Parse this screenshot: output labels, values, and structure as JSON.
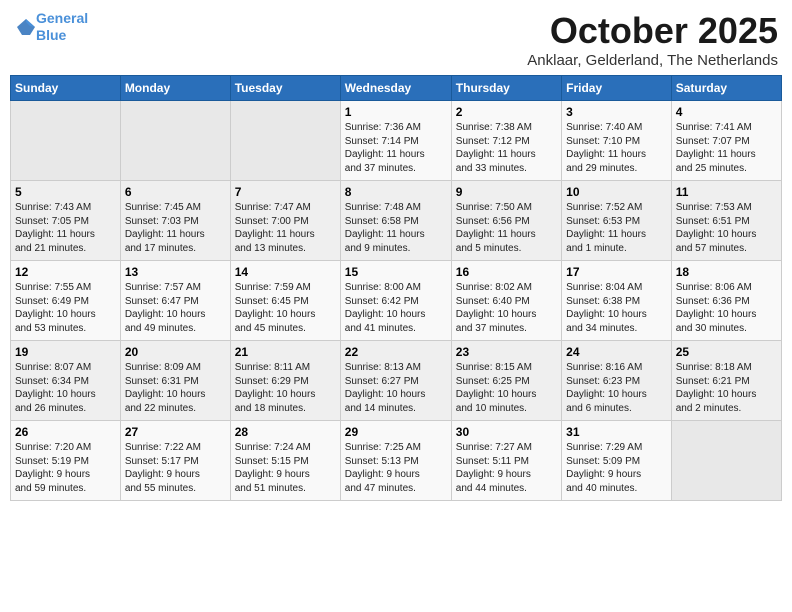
{
  "header": {
    "logo_line1": "General",
    "logo_line2": "Blue",
    "month": "October 2025",
    "location": "Anklaar, Gelderland, The Netherlands"
  },
  "weekdays": [
    "Sunday",
    "Monday",
    "Tuesday",
    "Wednesday",
    "Thursday",
    "Friday",
    "Saturday"
  ],
  "weeks": [
    [
      {
        "day": "",
        "info": ""
      },
      {
        "day": "",
        "info": ""
      },
      {
        "day": "",
        "info": ""
      },
      {
        "day": "1",
        "info": "Sunrise: 7:36 AM\nSunset: 7:14 PM\nDaylight: 11 hours\nand 37 minutes."
      },
      {
        "day": "2",
        "info": "Sunrise: 7:38 AM\nSunset: 7:12 PM\nDaylight: 11 hours\nand 33 minutes."
      },
      {
        "day": "3",
        "info": "Sunrise: 7:40 AM\nSunset: 7:10 PM\nDaylight: 11 hours\nand 29 minutes."
      },
      {
        "day": "4",
        "info": "Sunrise: 7:41 AM\nSunset: 7:07 PM\nDaylight: 11 hours\nand 25 minutes."
      }
    ],
    [
      {
        "day": "5",
        "info": "Sunrise: 7:43 AM\nSunset: 7:05 PM\nDaylight: 11 hours\nand 21 minutes."
      },
      {
        "day": "6",
        "info": "Sunrise: 7:45 AM\nSunset: 7:03 PM\nDaylight: 11 hours\nand 17 minutes."
      },
      {
        "day": "7",
        "info": "Sunrise: 7:47 AM\nSunset: 7:00 PM\nDaylight: 11 hours\nand 13 minutes."
      },
      {
        "day": "8",
        "info": "Sunrise: 7:48 AM\nSunset: 6:58 PM\nDaylight: 11 hours\nand 9 minutes."
      },
      {
        "day": "9",
        "info": "Sunrise: 7:50 AM\nSunset: 6:56 PM\nDaylight: 11 hours\nand 5 minutes."
      },
      {
        "day": "10",
        "info": "Sunrise: 7:52 AM\nSunset: 6:53 PM\nDaylight: 11 hours\nand 1 minute."
      },
      {
        "day": "11",
        "info": "Sunrise: 7:53 AM\nSunset: 6:51 PM\nDaylight: 10 hours\nand 57 minutes."
      }
    ],
    [
      {
        "day": "12",
        "info": "Sunrise: 7:55 AM\nSunset: 6:49 PM\nDaylight: 10 hours\nand 53 minutes."
      },
      {
        "day": "13",
        "info": "Sunrise: 7:57 AM\nSunset: 6:47 PM\nDaylight: 10 hours\nand 49 minutes."
      },
      {
        "day": "14",
        "info": "Sunrise: 7:59 AM\nSunset: 6:45 PM\nDaylight: 10 hours\nand 45 minutes."
      },
      {
        "day": "15",
        "info": "Sunrise: 8:00 AM\nSunset: 6:42 PM\nDaylight: 10 hours\nand 41 minutes."
      },
      {
        "day": "16",
        "info": "Sunrise: 8:02 AM\nSunset: 6:40 PM\nDaylight: 10 hours\nand 37 minutes."
      },
      {
        "day": "17",
        "info": "Sunrise: 8:04 AM\nSunset: 6:38 PM\nDaylight: 10 hours\nand 34 minutes."
      },
      {
        "day": "18",
        "info": "Sunrise: 8:06 AM\nSunset: 6:36 PM\nDaylight: 10 hours\nand 30 minutes."
      }
    ],
    [
      {
        "day": "19",
        "info": "Sunrise: 8:07 AM\nSunset: 6:34 PM\nDaylight: 10 hours\nand 26 minutes."
      },
      {
        "day": "20",
        "info": "Sunrise: 8:09 AM\nSunset: 6:31 PM\nDaylight: 10 hours\nand 22 minutes."
      },
      {
        "day": "21",
        "info": "Sunrise: 8:11 AM\nSunset: 6:29 PM\nDaylight: 10 hours\nand 18 minutes."
      },
      {
        "day": "22",
        "info": "Sunrise: 8:13 AM\nSunset: 6:27 PM\nDaylight: 10 hours\nand 14 minutes."
      },
      {
        "day": "23",
        "info": "Sunrise: 8:15 AM\nSunset: 6:25 PM\nDaylight: 10 hours\nand 10 minutes."
      },
      {
        "day": "24",
        "info": "Sunrise: 8:16 AM\nSunset: 6:23 PM\nDaylight: 10 hours\nand 6 minutes."
      },
      {
        "day": "25",
        "info": "Sunrise: 8:18 AM\nSunset: 6:21 PM\nDaylight: 10 hours\nand 2 minutes."
      }
    ],
    [
      {
        "day": "26",
        "info": "Sunrise: 7:20 AM\nSunset: 5:19 PM\nDaylight: 9 hours\nand 59 minutes."
      },
      {
        "day": "27",
        "info": "Sunrise: 7:22 AM\nSunset: 5:17 PM\nDaylight: 9 hours\nand 55 minutes."
      },
      {
        "day": "28",
        "info": "Sunrise: 7:24 AM\nSunset: 5:15 PM\nDaylight: 9 hours\nand 51 minutes."
      },
      {
        "day": "29",
        "info": "Sunrise: 7:25 AM\nSunset: 5:13 PM\nDaylight: 9 hours\nand 47 minutes."
      },
      {
        "day": "30",
        "info": "Sunrise: 7:27 AM\nSunset: 5:11 PM\nDaylight: 9 hours\nand 44 minutes."
      },
      {
        "day": "31",
        "info": "Sunrise: 7:29 AM\nSunset: 5:09 PM\nDaylight: 9 hours\nand 40 minutes."
      },
      {
        "day": "",
        "info": ""
      }
    ]
  ]
}
